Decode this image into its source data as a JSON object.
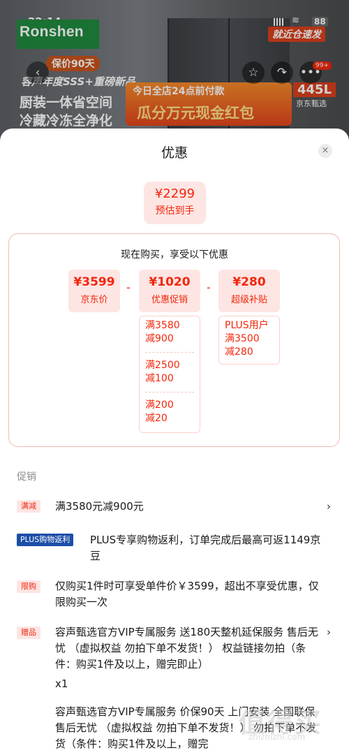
{
  "status_bar": {
    "time": "22:14",
    "battery": "88"
  },
  "banner": {
    "brand": "Ronshen",
    "warranty": "保价90天",
    "sss": "容声年度SSS+重磅新品",
    "slogan_line1": "厨装一体省空间",
    "slogan_line2": "冷藏冷冻全净化",
    "promo_line1": "今日全店24点前付款",
    "promo_line2": "瓜分万元现金红包",
    "delivery": "就近仓速发",
    "capacity": "445L",
    "channel": "京东甄选",
    "cart_badge": "99+"
  },
  "icons": {
    "back": "chevron-left-icon",
    "favorite": "star-icon",
    "share": "share-icon",
    "more": "more-icon",
    "close": "close-icon",
    "arrow": "chevron-right-icon"
  },
  "colors": {
    "accent": "#f2270c",
    "accent_bg": "#fde5e3",
    "plus_blue": "#1c4ea8"
  },
  "sheet": {
    "title": "优惠",
    "close": "×",
    "final_price": "¥2299",
    "final_label": "预估到手",
    "calc_title": "现在购买，享受以下优惠",
    "minus": "-",
    "boxes": [
      {
        "value": "¥3599",
        "label": "京东价"
      },
      {
        "value": "¥1020",
        "label": "优惠促销"
      },
      {
        "value": "¥280",
        "label": "超级补贴"
      }
    ],
    "promo_details": [
      {
        "line1": "满3580",
        "line2": "减900"
      },
      {
        "line1": "满2500",
        "line2": "减100"
      },
      {
        "line1": "满200",
        "line2": "减20"
      }
    ],
    "subsidy_details": [
      {
        "line1": "PLUS用户",
        "line2": "满3500",
        "line3": "减280"
      }
    ]
  },
  "promotions": {
    "section_label": "促销",
    "items": [
      {
        "tag": "满减",
        "text": "满3580元减900元",
        "has_arrow": true
      },
      {
        "tag": "PLUS购物返利",
        "text": "PLUS专享购物返利，订单完成后最高可返1149京豆",
        "has_arrow": false
      },
      {
        "tag": "限购",
        "text": "仅购买1件时可享受单件价￥3599，超出不享受优惠，仅限购买一次",
        "has_arrow": false
      },
      {
        "tag": "赠品",
        "text": "容声甄选官方VIP专属服务 送180天整机延保服务 售后无忧 （虚拟权益 勿拍下单不发货！） 权益链接勿拍（条件：购买1件及以上，赠完即止）",
        "qty": "x1",
        "has_arrow": true
      },
      {
        "tag": "",
        "text": "容声甄选官方VIP专属服务 价保90天 上门安装 全国联保 售后无忧 （虚拟权益 勿拍下单不发货！） 勿拍下单不发货（条件：购买1件及以上，赠完",
        "has_arrow": false
      }
    ],
    "arrow_glyph": "›"
  },
  "watermark": {
    "text": "值得买",
    "url": "zhizhizhi.com"
  }
}
